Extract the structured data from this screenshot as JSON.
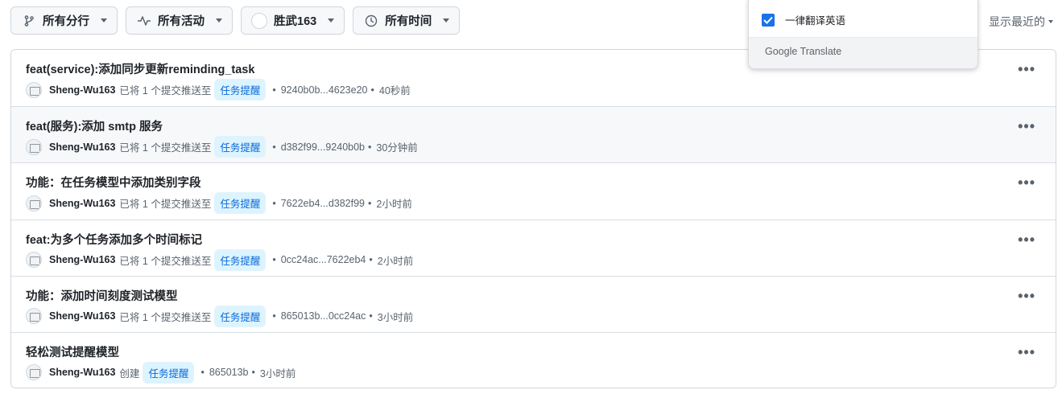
{
  "filters": [
    {
      "label": "所有分行",
      "icon": "branch-icon"
    },
    {
      "label": "所有活动",
      "icon": "pulse-icon"
    },
    {
      "label": "胜武163",
      "icon": "avatar"
    },
    {
      "label": "所有时间",
      "icon": "clock-icon"
    }
  ],
  "sort": {
    "label": "显示最近的"
  },
  "translate_popup": {
    "checkbox_label": "一律翻译英语",
    "checked": true,
    "brand_google": "Google",
    "brand_translate": "Translate"
  },
  "activities": [
    {
      "title": "feat(service):添加同步更新reminding_task",
      "user": "Sheng-Wu163",
      "action": "已将 1 个提交推送至",
      "branch": "任务提醒",
      "range": "9240b0b...4623e20",
      "time": "40秒前"
    },
    {
      "title": "feat(服务):添加 smtp 服务",
      "user": "Sheng-Wu163",
      "action": "已将 1 个提交推送至",
      "branch": "任务提醒",
      "range": "d382f99...9240b0b",
      "time": "30分钟前"
    },
    {
      "title": "功能：在任务模型中添加类别字段",
      "user": "Sheng-Wu163",
      "action": "已将 1 个提交推送至",
      "branch": "任务提醒",
      "range": "7622eb4...d382f99",
      "time": "2小时前"
    },
    {
      "title": "feat:为多个任务添加多个时间标记",
      "user": "Sheng-Wu163",
      "action": "已将 1 个提交推送至",
      "branch": "任务提醒",
      "range": "0cc24ac...7622eb4",
      "time": "2小时前"
    },
    {
      "title": "功能：添加时间刻度测试模型",
      "user": "Sheng-Wu163",
      "action": "已将 1 个提交推送至",
      "branch": "任务提醒",
      "range": "865013b...0cc24ac",
      "time": "3小时前"
    },
    {
      "title": "轻松测试提醒模型",
      "user": "Sheng-Wu163",
      "action": "创建",
      "branch": "任务提醒",
      "range": "865013b",
      "time": "3小时前"
    }
  ],
  "colors": {
    "accent": "#0969da",
    "branch_bg": "#ddf4ff",
    "checkbox": "#1a73e8",
    "border": "#d0d7de"
  }
}
